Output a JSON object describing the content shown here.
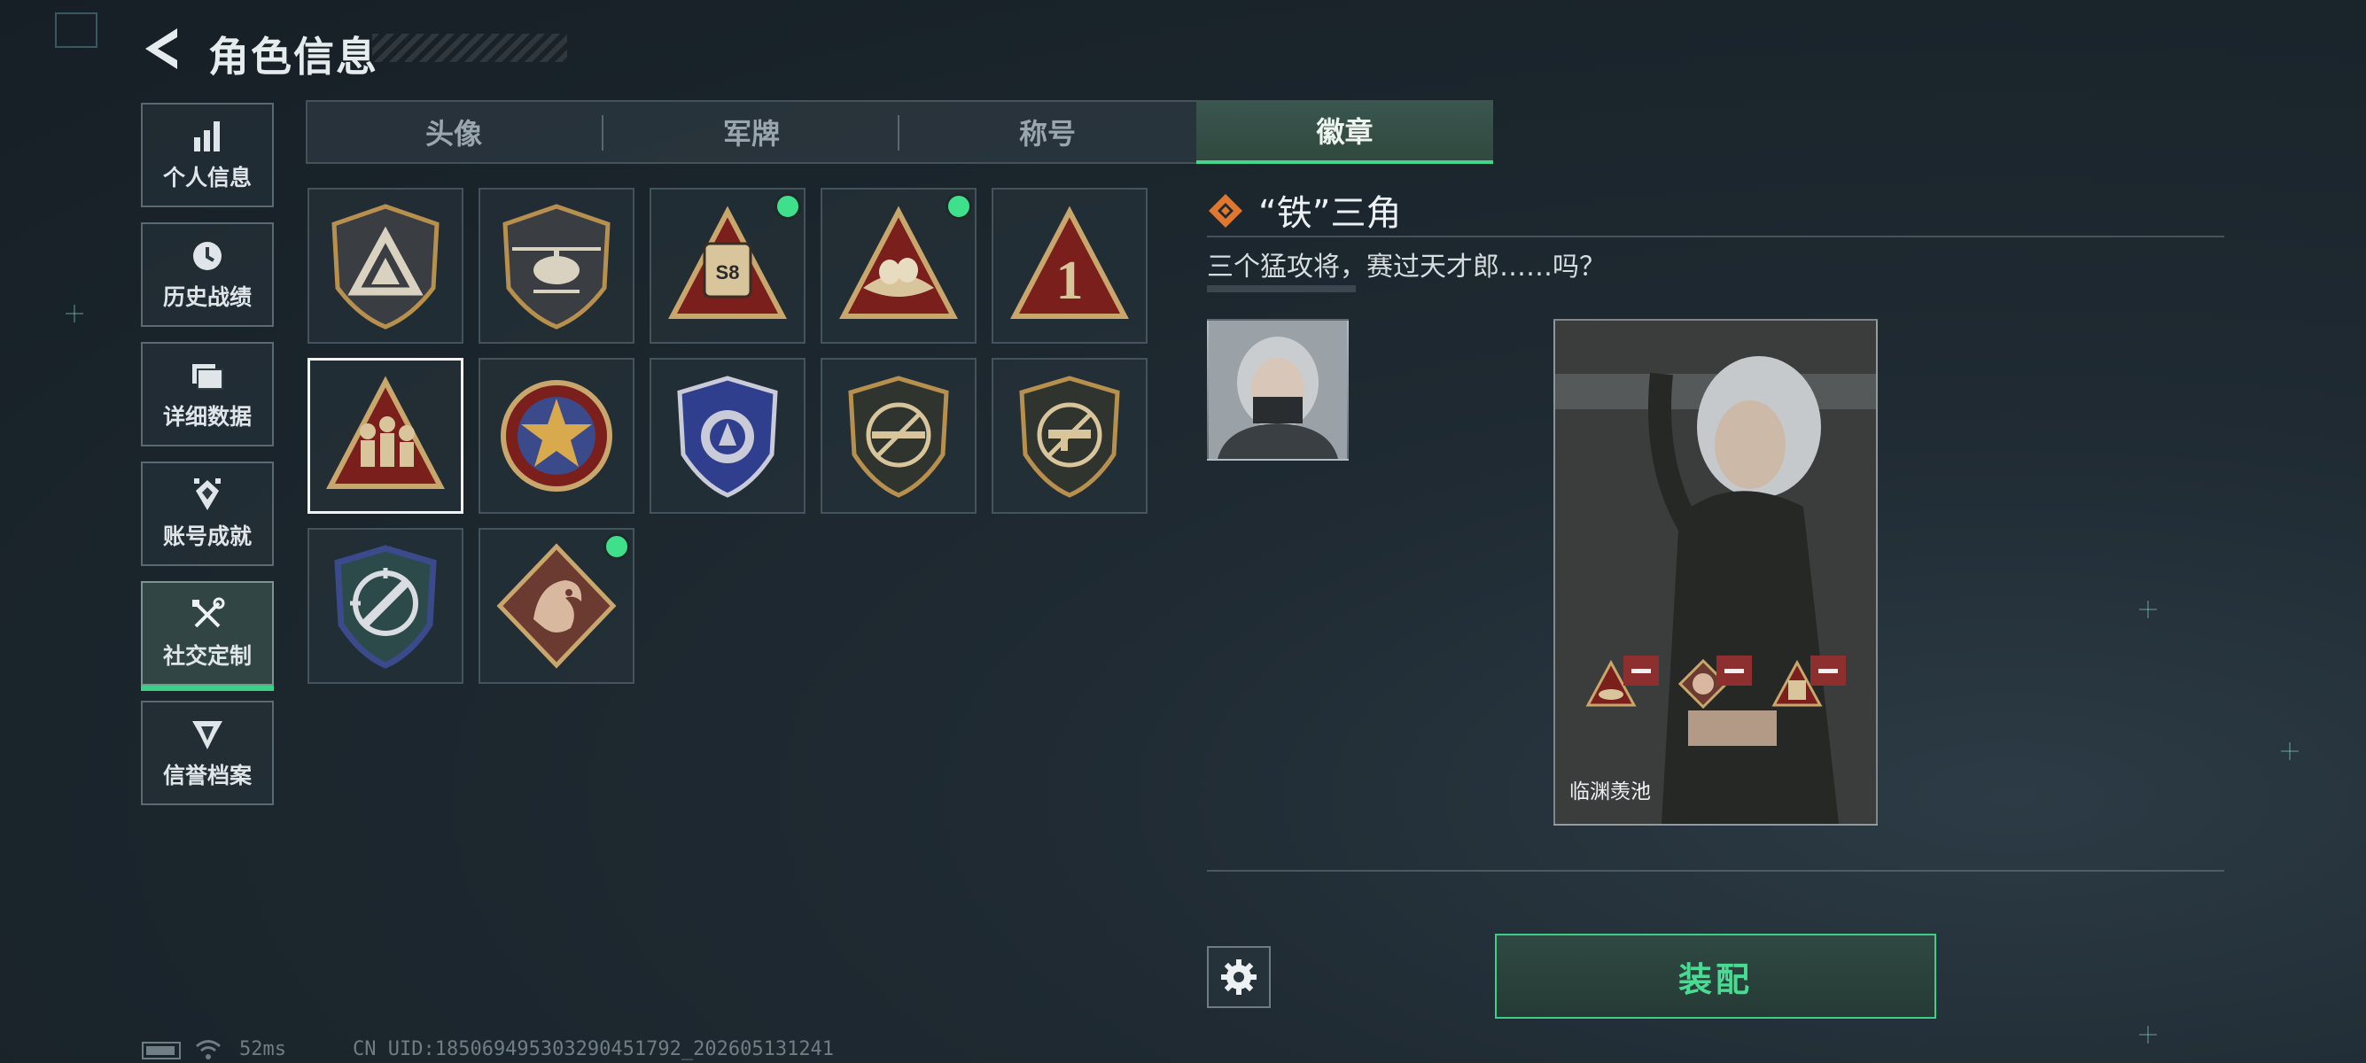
{
  "header": {
    "title": "角色信息"
  },
  "sidebar": {
    "items": [
      {
        "label": "个人信息",
        "icon": "bar-chart-icon"
      },
      {
        "label": "历史战绩",
        "icon": "clock-icon"
      },
      {
        "label": "详细数据",
        "icon": "folder-icon"
      },
      {
        "label": "账号成就",
        "icon": "achievement-icon"
      },
      {
        "label": "社交定制",
        "icon": "tools-icon",
        "active": true
      },
      {
        "label": "信誉档案",
        "icon": "reputation-icon"
      }
    ]
  },
  "tabs": [
    {
      "label": "头像"
    },
    {
      "label": "军牌"
    },
    {
      "label": "称号"
    },
    {
      "label": "徽章",
      "active": true
    }
  ],
  "badges": [
    {
      "icon": "triangle-emblem-shield-badge",
      "new": false
    },
    {
      "icon": "helicopter-shield-badge",
      "new": false
    },
    {
      "icon": "s8-truck-triangle-badge",
      "text": "S8",
      "new": true
    },
    {
      "icon": "nest-triangle-badge",
      "new": true
    },
    {
      "icon": "number-one-triangle-badge",
      "text": "1",
      "new": false
    },
    {
      "icon": "iron-triangle-soldiers-badge",
      "new": false,
      "selected": true
    },
    {
      "icon": "star-circle-badge",
      "new": false
    },
    {
      "icon": "blue-shield-badge",
      "new": false
    },
    {
      "icon": "no-rifle-shield-badge",
      "new": false
    },
    {
      "icon": "no-smg-shield-badge",
      "new": false
    },
    {
      "icon": "crosshair-knife-shield-badge",
      "new": false
    },
    {
      "icon": "dragon-diamond-badge",
      "new": true
    }
  ],
  "detail": {
    "name": "“铁”三角",
    "description": "三个猛攻将，赛过天才郎……吗？",
    "character_name": "临渊羡池"
  },
  "actions": {
    "equip_label": "装配"
  },
  "status": {
    "ping": "52ms",
    "uid": "CN UID:18506949530329045179​2_202605131241"
  },
  "colors": {
    "accent_green": "#3ecf86",
    "new_dot": "#3fe08c",
    "remove_red": "#8e2f2f",
    "badge_gold": "#c9a66b",
    "badge_red": "#7a1f1c"
  }
}
